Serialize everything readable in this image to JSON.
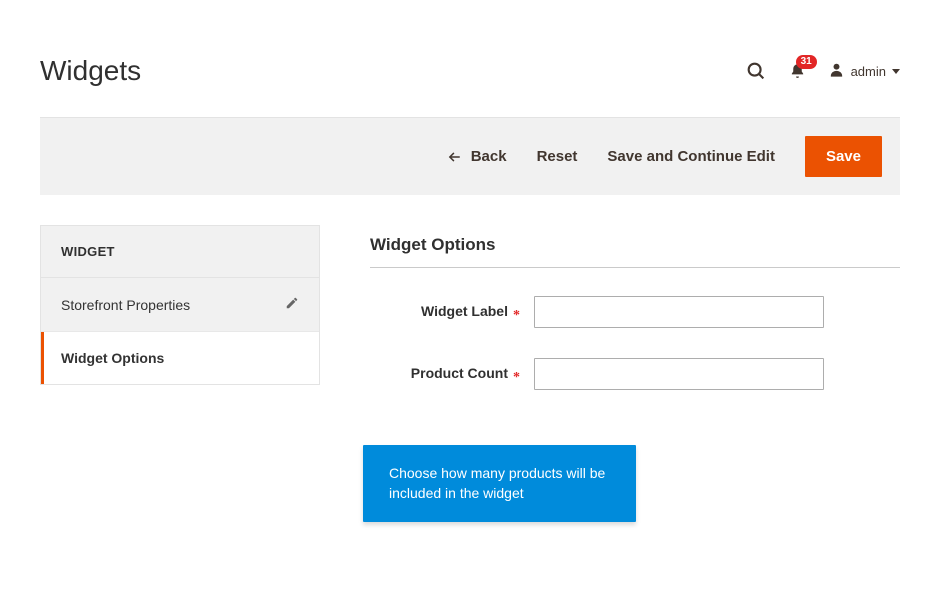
{
  "header": {
    "title": "Widgets",
    "notification_count": "31",
    "user_label": "admin"
  },
  "actions": {
    "back": "Back",
    "reset": "Reset",
    "save_continue": "Save and Continue Edit",
    "save": "Save"
  },
  "sidebar": {
    "section_label": "WIDGET",
    "items": [
      {
        "label": "Storefront Properties"
      },
      {
        "label": "Widget Options"
      }
    ]
  },
  "panel": {
    "title": "Widget Options",
    "fields": {
      "widget_label": {
        "label": "Widget Label",
        "value": ""
      },
      "product_count": {
        "label": "Product Count",
        "value": ""
      }
    },
    "tooltip": "Choose how many products will be included in the widget"
  }
}
